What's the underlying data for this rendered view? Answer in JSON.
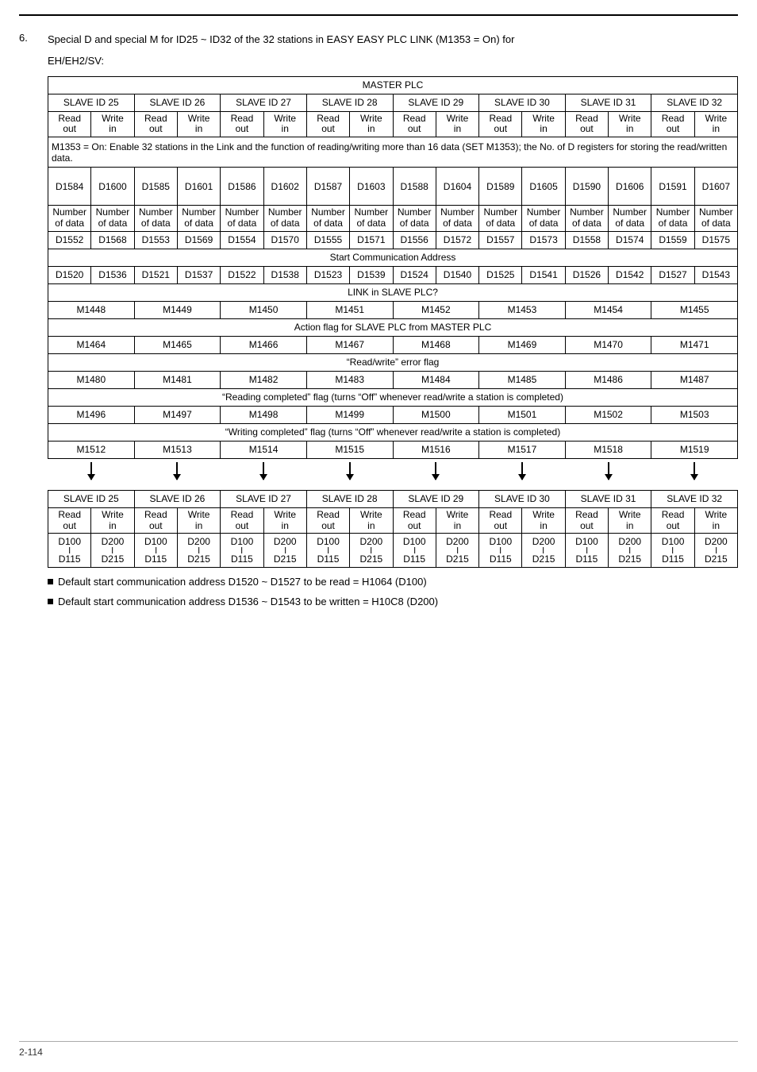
{
  "item_num": "6.",
  "item_text": "Special D and special M for ID25 ~ ID32 of the 32 stations in EASY EASY PLC LINK (M1353 = On) for",
  "subtext": "EH/EH2/SV:",
  "master": "MASTER PLC",
  "slave25": "SLAVE ID 25",
  "slave26": "SLAVE ID 26",
  "slave27": "SLAVE ID 27",
  "slave28": "SLAVE ID 28",
  "slave29": "SLAVE ID 29",
  "slave30": "SLAVE ID 30",
  "slave31": "SLAVE ID 31",
  "slave32": "SLAVE ID 32",
  "read_out": "Read out",
  "write_in": "Write in",
  "m1353_note": "M1353 = On: Enable 32 stations in the Link and the function of reading/writing more than 16 data (SET M1353); the No. of D registers for storing the read/written data.",
  "row_d1584": [
    "D1584",
    "D1600",
    "D1585",
    "D1601",
    "D1586",
    "D1602",
    "D1587",
    "D1603",
    "D1588",
    "D1604",
    "D1589",
    "D1605",
    "D1590",
    "D1606",
    "D1591",
    "D1607"
  ],
  "num_of_data": "Number of data",
  "row_d1552": [
    "D1552",
    "D1568",
    "D1553",
    "D1569",
    "D1554",
    "D1570",
    "D1555",
    "D1571",
    "D1556",
    "D1572",
    "D1557",
    "D1573",
    "D1558",
    "D1574",
    "D1559",
    "D1575"
  ],
  "start_comm": "Start Communication Address",
  "row_d1520": [
    "D1520",
    "D1536",
    "D1521",
    "D1537",
    "D1522",
    "D1538",
    "D1523",
    "D1539",
    "D1524",
    "D1540",
    "D1525",
    "D1541",
    "D1526",
    "D1542",
    "D1527",
    "D1543"
  ],
  "link_q": "LINK in SLAVE PLC?",
  "row_m1448": [
    "M1448",
    "M1449",
    "M1450",
    "M1451",
    "M1452",
    "M1453",
    "M1454",
    "M1455"
  ],
  "action_flag": "Action flag for SLAVE PLC from MASTER PLC",
  "row_m1464": [
    "M1464",
    "M1465",
    "M1466",
    "M1467",
    "M1468",
    "M1469",
    "M1470",
    "M1471"
  ],
  "rw_err": "“Read/write” error flag",
  "row_m1480": [
    "M1480",
    "M1481",
    "M1482",
    "M1483",
    "M1484",
    "M1485",
    "M1486",
    "M1487"
  ],
  "read_comp": "“Reading completed” flag (turns “Off” whenever read/write a station is completed)",
  "row_m1496": [
    "M1496",
    "M1497",
    "M1498",
    "M1499",
    "M1500",
    "M1501",
    "M1502",
    "M1503"
  ],
  "write_comp": "“Writing completed” flag (turns “Off” whenever read/write a station is completed)",
  "row_m1512": [
    "M1512",
    "M1513",
    "M1514",
    "M1515",
    "M1516",
    "M1517",
    "M1518",
    "M1519"
  ],
  "d_hdr_row": [
    "D100",
    "D200",
    "D100",
    "D200",
    "D100",
    "D200",
    "D100",
    "D200",
    "D100",
    "D200",
    "D100",
    "D200",
    "D100",
    "D200",
    "D100",
    "D200"
  ],
  "d_ftr_row": [
    "D115",
    "D215",
    "D115",
    "D215",
    "D115",
    "D215",
    "D115",
    "D215",
    "D115",
    "D215",
    "D115",
    "D215",
    "D115",
    "D215",
    "D115",
    "D215"
  ],
  "bullet1": "Default start communication address D1520 ~ D1527 to be read = H1064 (D100)",
  "bullet2": "Default start communication address D1536 ~ D1543 to be written = H10C8 (D200)",
  "footer": "2-114"
}
